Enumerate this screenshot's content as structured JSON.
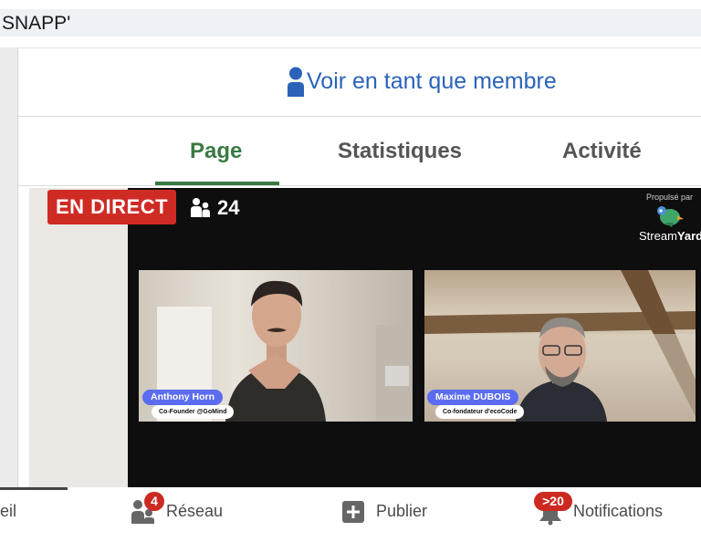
{
  "header": {
    "title": "SNAPP'"
  },
  "member_bar": {
    "label": "Voir en tant que membre"
  },
  "tabs": [
    {
      "label": "Page",
      "active": true
    },
    {
      "label": "Statistiques",
      "active": false
    },
    {
      "label": "Activité",
      "active": false
    }
  ],
  "live": {
    "badge": "EN DIRECT",
    "viewers": "24",
    "powered_by": "Propulsé par",
    "brand_part1": "Stream",
    "brand_part2": "Yard",
    "participants": [
      {
        "name": "Anthony Horn",
        "role": "Co-Founder @GoMind"
      },
      {
        "name": "Maxime DUBOIS",
        "role": "Co-fondateur d'ecoCode"
      }
    ]
  },
  "bottom_nav": {
    "items": [
      {
        "label": "eil",
        "icon": "home-icon"
      },
      {
        "label": "Réseau",
        "icon": "network-icon",
        "badge": "4"
      },
      {
        "label": "Publier",
        "icon": "plus-icon"
      },
      {
        "label": "Notifications",
        "icon": "bell-icon",
        "badge": ">20"
      }
    ]
  },
  "colors": {
    "accent": "#2b63b8",
    "active_tab": "#3a7a44",
    "live_red": "#cf2b25",
    "name_tag": "#5b6cf0"
  }
}
